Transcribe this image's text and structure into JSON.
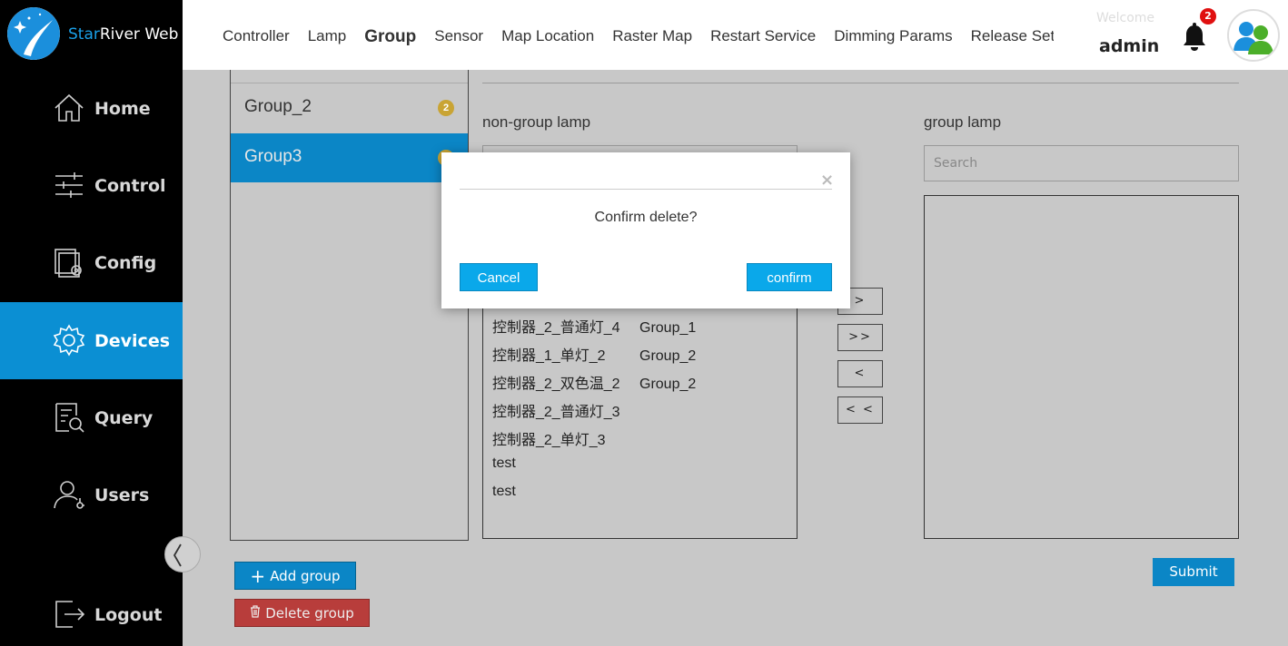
{
  "app": {
    "title_prefix": "Star",
    "title_suffix": "River Web"
  },
  "sidebar": {
    "items": [
      {
        "label": "Home",
        "icon": "home-icon"
      },
      {
        "label": "Control",
        "icon": "sliders-icon"
      },
      {
        "label": "Config",
        "icon": "config-icon"
      },
      {
        "label": "Devices",
        "icon": "gear-icon",
        "active": true
      },
      {
        "label": "Query",
        "icon": "query-icon"
      },
      {
        "label": "Users",
        "icon": "user-icon"
      },
      {
        "label": "Logout",
        "icon": "logout-icon"
      }
    ]
  },
  "topbar": {
    "tabs": [
      {
        "label": "Controller"
      },
      {
        "label": "Lamp"
      },
      {
        "label": "Group",
        "active": true
      },
      {
        "label": "Sensor"
      },
      {
        "label": "Map Location"
      },
      {
        "label": "Raster Map"
      },
      {
        "label": "Restart Service"
      },
      {
        "label": "Dimming Params"
      },
      {
        "label": "Release Set"
      }
    ],
    "welcome": "Welcome",
    "username": "admin",
    "notification_count": "2"
  },
  "groups": {
    "items": [
      {
        "label": "Group_2",
        "count": "2"
      },
      {
        "label": "Group3",
        "count": "0",
        "active": true
      }
    ]
  },
  "non_group": {
    "title": "non-group lamp",
    "rows": [
      {
        "name": "控制器_2_普通灯_4",
        "group": "Group_1"
      },
      {
        "name": "控制器_1_单灯_2",
        "group": "Group_2"
      },
      {
        "name": "控制器_2_双色温_2",
        "group": "Group_2"
      },
      {
        "name": "控制器_2_普通灯_3",
        "group": ""
      },
      {
        "name": "控制器_2_单灯_3",
        "group": ""
      },
      {
        "name": "test",
        "group": ""
      },
      {
        "name": "test",
        "group": ""
      }
    ]
  },
  "group_lamp": {
    "title": "group lamp",
    "search_placeholder": "Search"
  },
  "move_buttons": {
    "add_one": ">",
    "add_all": ">>",
    "remove_one": "<",
    "remove_all": "< <"
  },
  "actions": {
    "add_group": "Add group",
    "delete_group": "Delete group",
    "submit": "Submit"
  },
  "modal": {
    "close": "×",
    "message": "Confirm delete?",
    "cancel": "Cancel",
    "confirm": "confirm"
  },
  "colors": {
    "accent": "#0b86c6",
    "danger": "#b83d3b",
    "modal_button": "#0aa8ea",
    "sidebar_bg": "#000000"
  }
}
